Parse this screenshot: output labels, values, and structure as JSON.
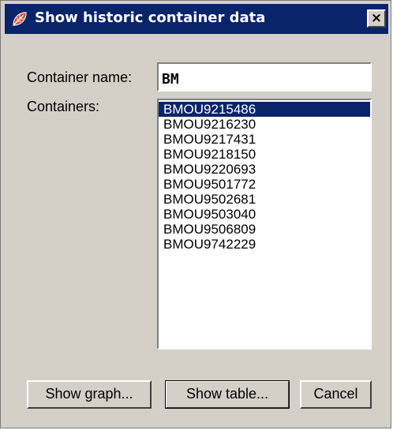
{
  "window": {
    "title": "Show historic container data",
    "close_glyph": "×",
    "icon": "app-leaf-icon"
  },
  "form": {
    "container_name_label": "Container name:",
    "container_name_value": "BM",
    "containers_label": "Containers:"
  },
  "containers": {
    "selected_index": 0,
    "items": [
      "BMOU9215486",
      "BMOU9216230",
      "BMOU9217431",
      "BMOU9218150",
      "BMOU9220693",
      "BMOU9501772",
      "BMOU9502681",
      "BMOU9503040",
      "BMOU9506809",
      "BMOU9742229"
    ]
  },
  "buttons": {
    "show_graph": "Show graph...",
    "show_table": "Show table...",
    "cancel": "Cancel"
  },
  "colors": {
    "titlebar": "#0a246a",
    "dialog_bg": "#d4d0c8",
    "selection": "#0a246a"
  }
}
